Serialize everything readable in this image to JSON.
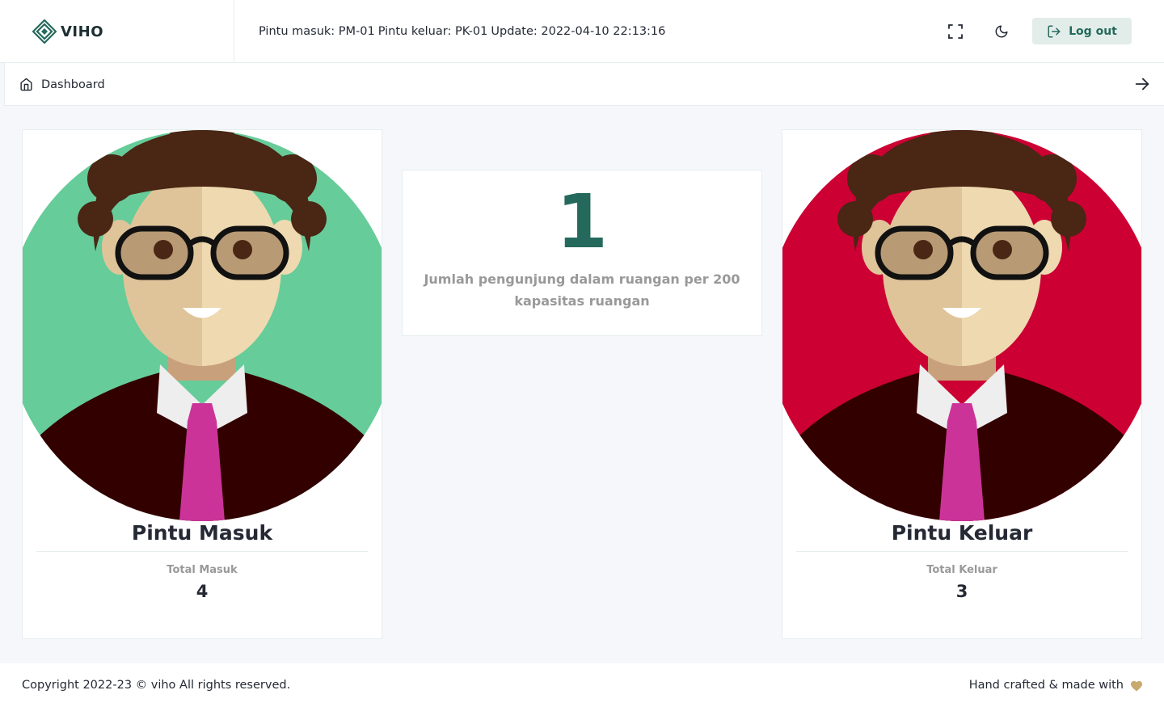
{
  "brand": {
    "name": "VIHO"
  },
  "header": {
    "status_parts": [
      "Pintu masuk: PM-01",
      "Pintu keluar: PK-01",
      "Update: 2022-04-10 22:13:16"
    ],
    "logout_label": "Log out",
    "icons": {
      "fullscreen": "maximize-icon",
      "theme": "moon-icon",
      "logout": "log-out-icon"
    }
  },
  "breadcrumb": {
    "label": "Dashboard",
    "icon": "home-icon"
  },
  "cards": {
    "entry": {
      "title": "Pintu Masuk",
      "total_label": "Total Masuk",
      "total": "4",
      "avatar_bg": "#66cc99"
    },
    "occupancy": {
      "count": "1",
      "description": "Jumlah pengunjung dalam ruangan per 200 kapasitas ruangan"
    },
    "exit": {
      "title": "Pintu Keluar",
      "total_label": "Total Keluar",
      "total": "3",
      "avatar_bg": "#cc0033"
    }
  },
  "footer": {
    "copyright": "Copyright 2022-23 © viho All rights reserved.",
    "crafted": "Hand crafted & made with",
    "heart_color": "#c8a96e"
  },
  "colors": {
    "primary": "#24695c",
    "muted": "#999999"
  }
}
